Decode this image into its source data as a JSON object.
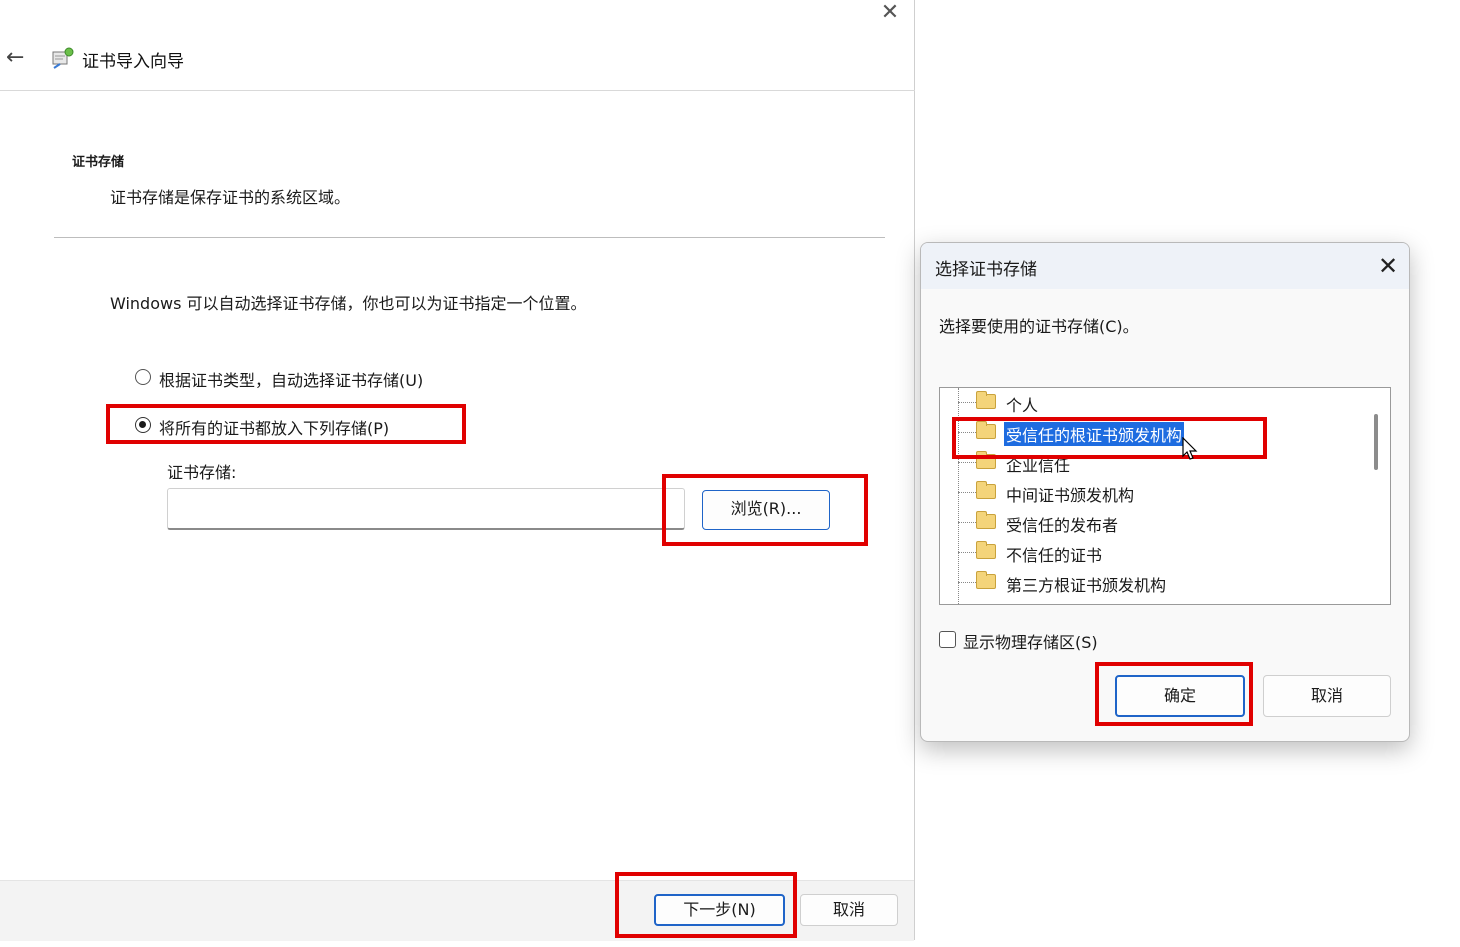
{
  "wizard": {
    "title": "证书导入向导",
    "section_title": "证书存储",
    "section_desc": "证书存储是保存证书的系统区域。",
    "intro": "Windows 可以自动选择证书存储，你也可以为证书指定一个位置。",
    "radio_auto": "根据证书类型，自动选择证书存储(U)",
    "radio_manual": "将所有的证书都放入下列存储(P)",
    "store_label": "证书存储:",
    "store_value": "",
    "browse_label": "浏览(R)...",
    "next_label": "下一步(N)",
    "cancel_label": "取消",
    "close_glyph": "✕",
    "back_glyph": "←"
  },
  "dialog": {
    "title": "选择证书存储",
    "close_glyph": "✕",
    "prompt": "选择要使用的证书存储(C)。",
    "tree_items": [
      {
        "label": "个人"
      },
      {
        "label": "受信任的根证书颁发机构",
        "selected": true
      },
      {
        "label": "企业信任"
      },
      {
        "label": "中间证书颁发机构"
      },
      {
        "label": "受信任的发布者"
      },
      {
        "label": "不信任的证书"
      },
      {
        "label": "第三方根证书颁发机构"
      }
    ],
    "show_physical": "显示物理存储区(S)",
    "ok_label": "确定",
    "cancel_label": "取消"
  },
  "colors": {
    "highlight_box": "#e00000",
    "selection": "#1e6ce0",
    "accent_border": "#1f64c8"
  }
}
